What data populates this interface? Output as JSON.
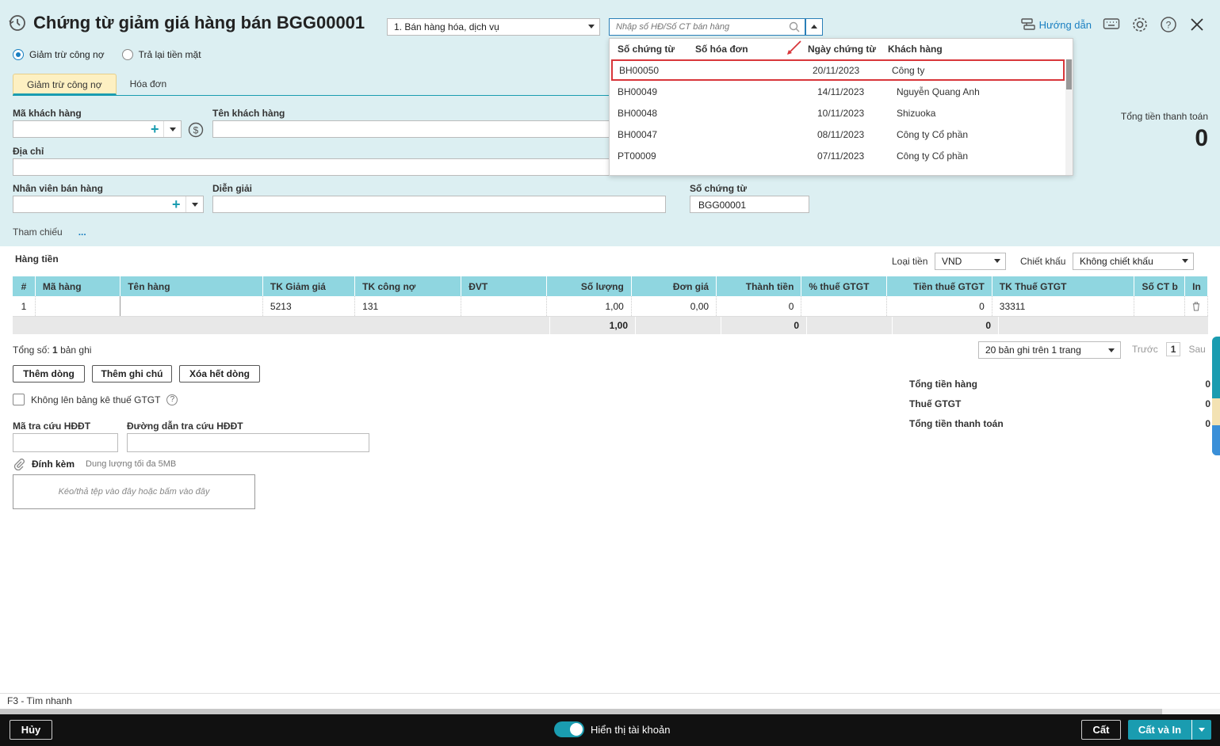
{
  "header": {
    "title": "Chứng từ giảm giá hàng bán BGG00001",
    "type_select": "1. Bán hàng hóa, dịch vụ",
    "search_placeholder": "Nhập số HĐ/Số CT bán hàng",
    "help_label": "Hướng dẫn"
  },
  "radios": [
    {
      "label": "Giảm trừ công nợ",
      "checked": true
    },
    {
      "label": "Trả lại tiền mặt",
      "checked": false
    }
  ],
  "tabs": [
    "Giảm trừ công nợ",
    "Hóa đơn"
  ],
  "form": {
    "customer_code_label": "Mã khách hàng",
    "customer_name_label": "Tên khách hàng",
    "address_label": "Địa chỉ",
    "salesperson_label": "Nhân viên bán hàng",
    "description_label": "Diễn giải",
    "voucher_no_label": "Số chứng từ",
    "voucher_no_value": "BGG00001",
    "reference_label": "Tham chiếu",
    "reference_more": "..."
  },
  "total": {
    "label": "Tổng tiền thanh toán",
    "value": "0"
  },
  "dropdown": {
    "headers": [
      "Số chứng từ",
      "Số hóa đơn",
      "Ngày chứng từ",
      "Khách hàng"
    ],
    "rows": [
      {
        "no": "BH00050",
        "invoice": "",
        "date": "20/11/2023",
        "customer": "Công ty"
      },
      {
        "no": "BH00049",
        "invoice": "",
        "date": "14/11/2023",
        "customer": "Nguyễn Quang Anh"
      },
      {
        "no": "BH00048",
        "invoice": "",
        "date": "10/11/2023",
        "customer": "Shizuoka"
      },
      {
        "no": "BH00047",
        "invoice": "",
        "date": "08/11/2023",
        "customer": "Công ty Cổ phần"
      },
      {
        "no": "PT00009",
        "invoice": "",
        "date": "07/11/2023",
        "customer": "Công ty Cổ phần"
      }
    ]
  },
  "items_section": {
    "title": "Hàng tiền",
    "currency_label": "Loại tiền",
    "currency_value": "VND",
    "discount_label": "Chiết khấu",
    "discount_value": "Không chiết khấu"
  },
  "grid": {
    "headers": [
      "#",
      "Mã hàng",
      "Tên hàng",
      "TK Giảm giá",
      "TK công nợ",
      "ĐVT",
      "Số lượng",
      "Đơn giá",
      "Thành tiền",
      "% thuế GTGT",
      "Tiền thuế GTGT",
      "TK Thuế GTGT",
      "Số CT b",
      "In"
    ],
    "rows": [
      [
        "1",
        "",
        "",
        "5213",
        "131",
        "",
        "1,00",
        "0,00",
        "0",
        "",
        "0",
        "33311",
        "",
        ""
      ]
    ],
    "summary": {
      "qty": "1,00",
      "amount": "0",
      "tax": "0"
    }
  },
  "pager": {
    "total_prefix": "Tổng số:",
    "total_count": "1",
    "total_suffix": "bản ghi",
    "per_page": "20 bản ghi trên 1 trang",
    "prev": "Trước",
    "page": "1",
    "next": "Sau"
  },
  "actions": {
    "add_row": "Thêm dòng",
    "add_note": "Thêm ghi chú",
    "clear_rows": "Xóa hết dòng"
  },
  "vat_checkbox": "Không lên bảng kê thuế GTGT",
  "einvoice": {
    "lookup_code_label": "Mã tra cứu HĐĐT",
    "lookup_url_label": "Đường dẫn tra cứu HĐĐT"
  },
  "attachment": {
    "label": "Đính kèm",
    "hint": "Dung lượng tối đa 5MB",
    "drop": "Kéo/thả tệp vào đây hoặc bấm vào đây"
  },
  "summary": [
    {
      "label": "Tổng tiền hàng",
      "value": "0"
    },
    {
      "label": "Thuế GTGT",
      "value": "0"
    },
    {
      "label": "Tổng tiền thanh toán",
      "value": "0"
    }
  ],
  "hint_bar": "F3 - Tìm nhanh",
  "footer": {
    "cancel": "Hủy",
    "show_accounts": "Hiển thị tài khoản",
    "save": "Cất",
    "save_print": "Cất và In"
  },
  "colors": {
    "accent": "#1a9cb0",
    "header_bg": "#dceff2",
    "highlight": "#d8363a",
    "active_tab": "#fdf0c2"
  }
}
